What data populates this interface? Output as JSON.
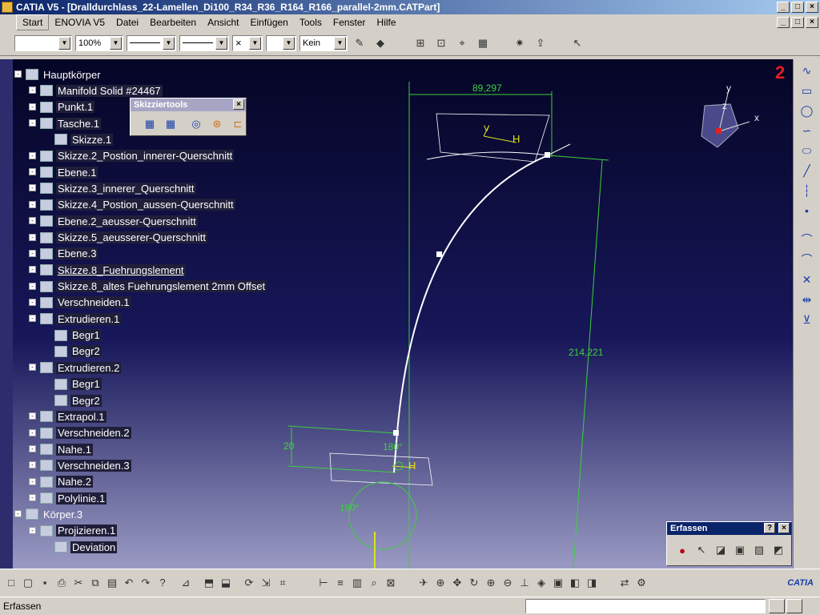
{
  "window": {
    "title": "CATIA V5 - [Dralldurchlass_22-Lamellen_Di100_R34_R36_R164_R166_parallel-2mm.CATPart]",
    "min": "_",
    "max": "□",
    "close": "×"
  },
  "menu": [
    "Start",
    "ENOVIA V5",
    "Datei",
    "Bearbeiten",
    "Ansicht",
    "Einfügen",
    "Tools",
    "Fenster",
    "Hilfe"
  ],
  "format_bar": {
    "zoom": "100%",
    "layer": "Kein"
  },
  "tree": {
    "nodes": [
      {
        "label": "Hauptkörper",
        "level": 0,
        "selected": false,
        "underline": false
      },
      {
        "label": "Manifold Solid #24467",
        "level": 1,
        "selected": true,
        "underline": false
      },
      {
        "label": "Punkt.1",
        "level": 1,
        "selected": true,
        "underline": false
      },
      {
        "label": "Tasche.1",
        "level": 1,
        "selected": true,
        "underline": false
      },
      {
        "label": "Skizze.1",
        "level": 2,
        "selected": true,
        "underline": false
      },
      {
        "label": "Skizze.2_Postion_innerer-Querschnitt",
        "level": 1,
        "selected": true,
        "underline": false
      },
      {
        "label": "Ebene.1",
        "level": 1,
        "selected": true,
        "underline": false
      },
      {
        "label": "Skizze.3_innerer_Querschnitt",
        "level": 1,
        "selected": true,
        "underline": false
      },
      {
        "label": "Skizze.4_Postion_aussen-Querschnitt",
        "level": 1,
        "selected": true,
        "underline": false
      },
      {
        "label": "Ebene.2_aeusser-Querschnitt",
        "level": 1,
        "selected": true,
        "underline": false
      },
      {
        "label": "Skizze.5_aeusserer-Querschnitt",
        "level": 1,
        "selected": true,
        "underline": false
      },
      {
        "label": "Ebene.3",
        "level": 1,
        "selected": true,
        "underline": false
      },
      {
        "label": "Skizze.8_Fuehrungslement",
        "level": 1,
        "selected": true,
        "underline": true
      },
      {
        "label": "Skizze.8_altes Fuehrungslement 2mm Offset",
        "level": 1,
        "selected": true,
        "underline": false
      },
      {
        "label": "Verschneiden.1",
        "level": 1,
        "selected": true,
        "underline": false
      },
      {
        "label": "Extrudieren.1",
        "level": 1,
        "selected": true,
        "underline": false
      },
      {
        "label": "Begr1",
        "level": 2,
        "selected": true,
        "underline": false
      },
      {
        "label": "Begr2",
        "level": 2,
        "selected": true,
        "underline": false
      },
      {
        "label": "Extrudieren.2",
        "level": 1,
        "selected": true,
        "underline": false
      },
      {
        "label": "Begr1",
        "level": 2,
        "selected": true,
        "underline": false
      },
      {
        "label": "Begr2",
        "level": 2,
        "selected": true,
        "underline": false
      },
      {
        "label": "Extrapol.1",
        "level": 1,
        "selected": true,
        "underline": false
      },
      {
        "label": "Verschneiden.2",
        "level": 1,
        "selected": true,
        "underline": false
      },
      {
        "label": "Nahe.1",
        "level": 1,
        "selected": true,
        "underline": false
      },
      {
        "label": "Verschneiden.3",
        "level": 1,
        "selected": true,
        "underline": false
      },
      {
        "label": "Nahe.2",
        "level": 1,
        "selected": true,
        "underline": false
      },
      {
        "label": "Polylinie.1",
        "level": 1,
        "selected": true,
        "underline": false
      },
      {
        "label": "Körper.3",
        "level": 0,
        "selected": false,
        "underline": false
      },
      {
        "label": "Projizieren.1",
        "level": 1,
        "selected": true,
        "underline": false
      },
      {
        "label": "Deviation",
        "level": 2,
        "selected": true,
        "underline": false
      }
    ]
  },
  "skizziertools": {
    "title": "Skizziertools",
    "close": "×"
  },
  "erfassen_panel": {
    "title": "Erfassen",
    "help": "?",
    "close": "×"
  },
  "viewport": {
    "dim_width": "89,297",
    "dim_height": "214,221",
    "dim_small": "20",
    "angle_top": "180°",
    "angle_bottom": "180°",
    "axis_x": "x",
    "axis_y": "y",
    "axis_z": "z",
    "sketch_h": "H",
    "sketch_v": "V",
    "badge": "2"
  },
  "status": {
    "text": "Erfassen"
  },
  "brand": {
    "logo": "CATIA"
  }
}
